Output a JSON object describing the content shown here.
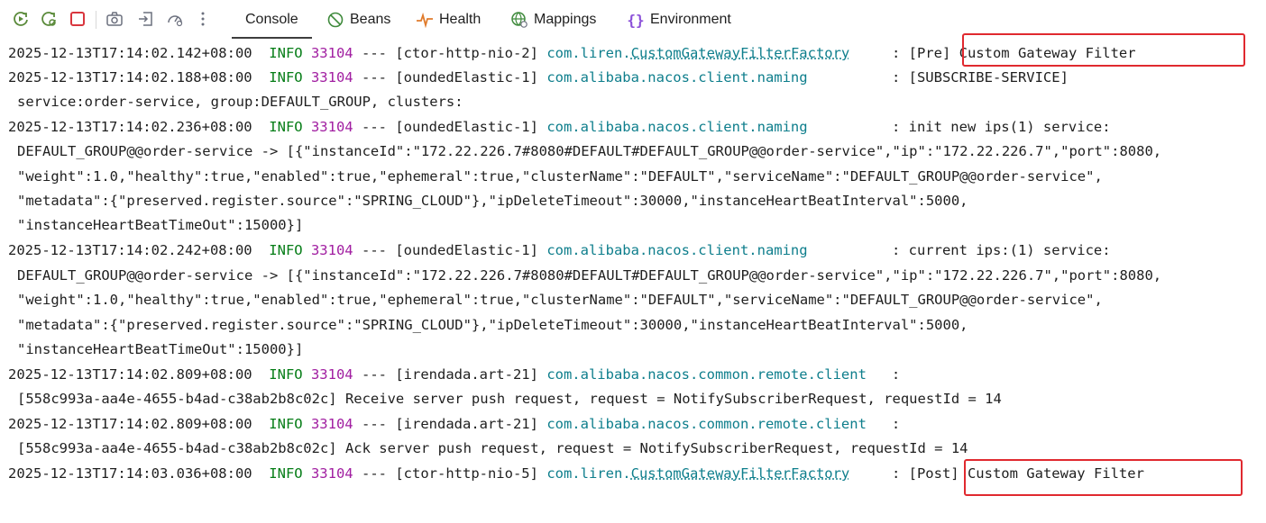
{
  "tabs": {
    "console": "Console",
    "beans": "Beans",
    "health": "Health",
    "mappings": "Mappings",
    "environment": "Environment"
  },
  "log": [
    {
      "ts": "2025-12-13T17:14:02.142+08:00",
      "level": "INFO",
      "pid": "33104",
      "sep": "---",
      "thread": "[ctor-http-nio-2]",
      "logger_pkg": "com.liren.",
      "logger_cls": "CustomGatewayFilterFactory",
      "colon": ":",
      "msg": "[Pre] Custom Gateway Filter"
    },
    {
      "ts": "2025-12-13T17:14:02.188+08:00",
      "level": "INFO",
      "pid": "33104",
      "sep": "---",
      "thread": "[oundedElastic-1]",
      "logger": "com.alibaba.nacos.client.naming",
      "colon": ":",
      "msg": "[SUBSCRIBE-SERVICE]",
      "cont": [
        "service:order-service, group:DEFAULT_GROUP, clusters:"
      ]
    },
    {
      "ts": "2025-12-13T17:14:02.236+08:00",
      "level": "INFO",
      "pid": "33104",
      "sep": "---",
      "thread": "[oundedElastic-1]",
      "logger": "com.alibaba.nacos.client.naming",
      "colon": ":",
      "msg": "init new ips(1) service:",
      "cont": [
        "DEFAULT_GROUP@@order-service -> [{\"instanceId\":\"172.22.226.7#8080#DEFAULT#DEFAULT_GROUP@@order-service\",\"ip\":\"172.22.226.7\",\"port\":8080,",
        "\"weight\":1.0,\"healthy\":true,\"enabled\":true,\"ephemeral\":true,\"clusterName\":\"DEFAULT\",\"serviceName\":\"DEFAULT_GROUP@@order-service\",",
        "\"metadata\":{\"preserved.register.source\":\"SPRING_CLOUD\"},\"ipDeleteTimeout\":30000,\"instanceHeartBeatInterval\":5000,",
        "\"instanceHeartBeatTimeOut\":15000}]"
      ]
    },
    {
      "ts": "2025-12-13T17:14:02.242+08:00",
      "level": "INFO",
      "pid": "33104",
      "sep": "---",
      "thread": "[oundedElastic-1]",
      "logger": "com.alibaba.nacos.client.naming",
      "colon": ":",
      "msg": "current ips:(1) service:",
      "cont": [
        "DEFAULT_GROUP@@order-service -> [{\"instanceId\":\"172.22.226.7#8080#DEFAULT#DEFAULT_GROUP@@order-service\",\"ip\":\"172.22.226.7\",\"port\":8080,",
        "\"weight\":1.0,\"healthy\":true,\"enabled\":true,\"ephemeral\":true,\"clusterName\":\"DEFAULT\",\"serviceName\":\"DEFAULT_GROUP@@order-service\",",
        "\"metadata\":{\"preserved.register.source\":\"SPRING_CLOUD\"},\"ipDeleteTimeout\":30000,\"instanceHeartBeatInterval\":5000,",
        "\"instanceHeartBeatTimeOut\":15000}]"
      ]
    },
    {
      "ts": "2025-12-13T17:14:02.809+08:00",
      "level": "INFO",
      "pid": "33104",
      "sep": "---",
      "thread": "[irendada.art-21]",
      "logger": "com.alibaba.nacos.common.remote.client",
      "colon": ":",
      "msg": "",
      "cont": [
        "[558c993a-aa4e-4655-b4ad-c38ab2b8c02c] Receive server push request, request = NotifySubscriberRequest, requestId = 14"
      ]
    },
    {
      "ts": "2025-12-13T17:14:02.809+08:00",
      "level": "INFO",
      "pid": "33104",
      "sep": "---",
      "thread": "[irendada.art-21]",
      "logger": "com.alibaba.nacos.common.remote.client",
      "colon": ":",
      "msg": "",
      "cont": [
        "[558c993a-aa4e-4655-b4ad-c38ab2b8c02c] Ack server push request, request = NotifySubscriberRequest, requestId = 14"
      ]
    },
    {
      "ts": "2025-12-13T17:14:03.036+08:00",
      "level": "INFO",
      "pid": "33104",
      "sep": "---",
      "thread": "[ctor-http-nio-5]",
      "logger_pkg": "com.liren.",
      "logger_cls": "CustomGatewayFilterFactory",
      "colon": ":",
      "msg": "[Post] Custom Gateway Filter"
    }
  ],
  "colors": {
    "highlight": "#e0292f",
    "info": "#067d17",
    "pid": "#a11ea1",
    "logger": "#0e7e8c"
  }
}
